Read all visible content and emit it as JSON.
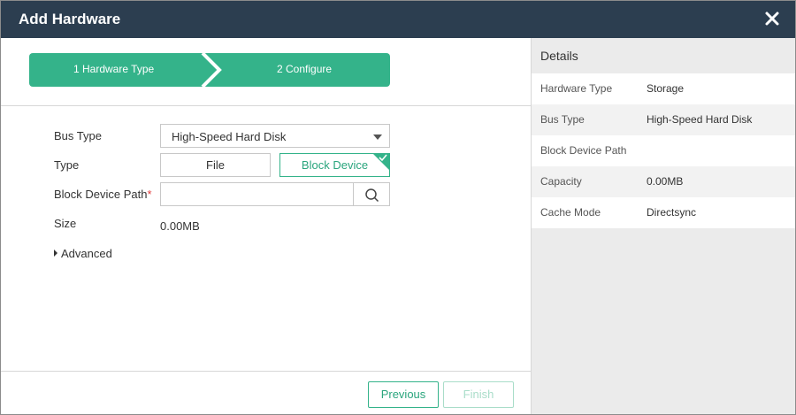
{
  "dialog": {
    "title": "Add Hardware"
  },
  "wizard": {
    "steps": [
      {
        "label": "1 Hardware Type"
      },
      {
        "label": "2 Configure"
      }
    ],
    "accent_color": "#34b38a"
  },
  "form": {
    "bus_type": {
      "label": "Bus Type",
      "value": "High-Speed Hard Disk"
    },
    "type": {
      "label": "Type",
      "options": [
        "File",
        "Block Device"
      ],
      "selected": "Block Device"
    },
    "block_device_path": {
      "label": "Block Device Path",
      "required_mark": "*",
      "value": "",
      "placeholder": ""
    },
    "size": {
      "label": "Size",
      "value": "0.00MB"
    },
    "advanced": {
      "label": "Advanced"
    }
  },
  "footer": {
    "previous_label": "Previous",
    "finish_label": "Finish"
  },
  "details": {
    "title": "Details",
    "rows": [
      {
        "key": "Hardware Type",
        "value": "Storage"
      },
      {
        "key": "Bus Type",
        "value": "High-Speed Hard Disk"
      },
      {
        "key": "Block Device Path",
        "value": ""
      },
      {
        "key": "Capacity",
        "value": "0.00MB"
      },
      {
        "key": "Cache Mode",
        "value": "Directsync"
      }
    ]
  },
  "colors": {
    "titlebar": "#2c3e50",
    "accent": "#34b38a"
  }
}
